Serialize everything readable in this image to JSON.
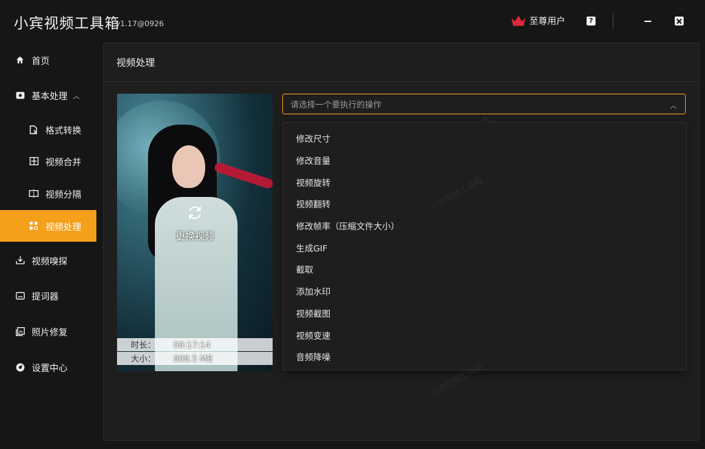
{
  "app": {
    "title": "小宾视频工具箱",
    "version": "v1.17@0926",
    "vip_label": "至尊用户",
    "help_label": "?"
  },
  "sidebar": {
    "items": [
      {
        "label": "首页",
        "icon": "home-icon"
      },
      {
        "label": "基本处理",
        "icon": "basic-process-icon",
        "expanded": true
      },
      {
        "label": "格式转换",
        "icon": "file-convert-icon"
      },
      {
        "label": "视频合并",
        "icon": "merge-icon"
      },
      {
        "label": "视频分隔",
        "icon": "split-icon"
      },
      {
        "label": "视频处理",
        "icon": "process-icon",
        "active": true
      },
      {
        "label": "视频嗅探",
        "icon": "download-icon"
      },
      {
        "label": "提词器",
        "icon": "teleprompter-icon"
      },
      {
        "label": "照片修复",
        "icon": "photo-repair-icon"
      },
      {
        "label": "设置中心",
        "icon": "settings-icon"
      }
    ]
  },
  "main": {
    "title": "视频处理",
    "video": {
      "replace_label": "更换视频",
      "duration_label": "时长：",
      "duration_value": "00:17:14",
      "size_label": "大小：",
      "size_value": "808.5 MB"
    },
    "operation_select": {
      "placeholder": "请选择一个要执行的操作",
      "options": [
        "修改尺寸",
        "修改音量",
        "视频旋转",
        "视频翻转",
        "修改帧率（压缩文件大小）",
        "生成GIF",
        "截取",
        "添加水印",
        "视频截图",
        "视频变速",
        "音频降噪"
      ]
    },
    "watermark_text": "小宾视频工具箱"
  },
  "colors": {
    "accent": "#f5a01a",
    "background": "#161616",
    "panel": "#1e1e1f"
  }
}
